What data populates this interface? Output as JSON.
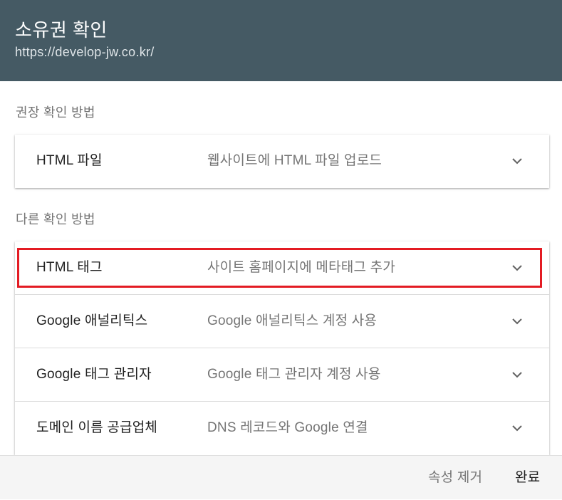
{
  "header": {
    "title": "소유권 확인",
    "url": "https://develop-jw.co.kr/",
    "background": "#455a64"
  },
  "recommended": {
    "label": "권장 확인 방법",
    "methods": [
      {
        "name": "HTML 파일",
        "description": "웹사이트에 HTML 파일 업로드",
        "icon": "chevron-down-icon"
      }
    ]
  },
  "other": {
    "label": "다른 확인 방법",
    "methods": [
      {
        "name": "HTML 태그",
        "description": "사이트 홈페이지에 메타태그 추가",
        "icon": "chevron-down-icon",
        "highlighted": true
      },
      {
        "name": "Google 애널리틱스",
        "description": "Google 애널리틱스 계정 사용",
        "icon": "chevron-down-icon"
      },
      {
        "name": "Google 태그 관리자",
        "description": "Google 태그 관리자 계정 사용",
        "icon": "chevron-down-icon"
      },
      {
        "name": "도메인 이름 공급업체",
        "description": "DNS 레코드와 Google 연결",
        "icon": "chevron-down-icon"
      }
    ]
  },
  "footer": {
    "remove_label": "속성 제거",
    "done_label": "완료"
  },
  "colors": {
    "highlight": "#e31b23"
  }
}
